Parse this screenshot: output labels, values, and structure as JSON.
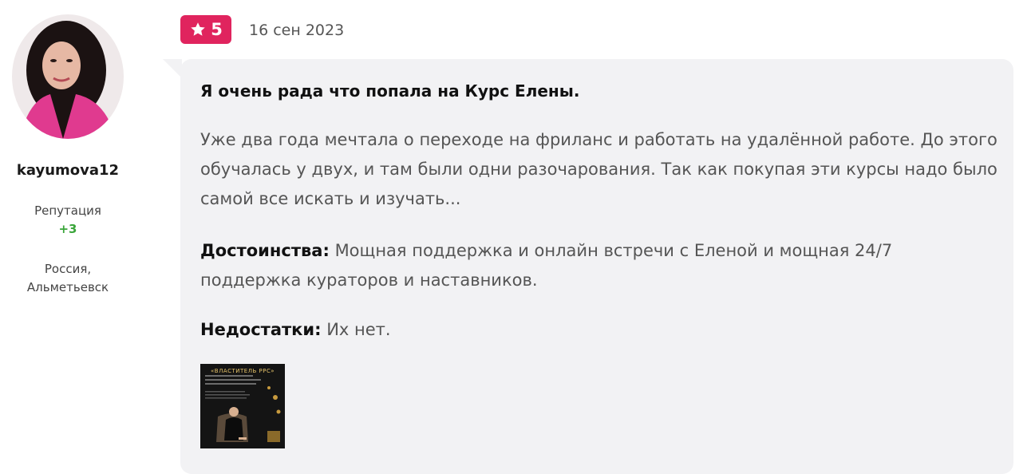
{
  "author": {
    "username": "kayumova12",
    "reputation_label": "Репутация",
    "reputation_value": "+3",
    "location_line1": "Россия,",
    "location_line2": "Альметьевск"
  },
  "review": {
    "rating": "5",
    "date": "16 сен 2023",
    "title": "Я очень рада что попала на Курс Елены.",
    "body": "Уже два года мечтала о переходе на фриланс и работать на удалённой работе. До этого обучалась у двух, и там были одни разочарования. Так как покупая эти курсы надо было самой все искать и изучать...",
    "pros_label": "Достоинства:",
    "pros_text": " Мощная поддержка и онлайн встречи с Еленой и мощная 24/7 поддержка кураторов и наставников.",
    "cons_label": "Недостатки:",
    "cons_text": " Их нет.",
    "attachment_title": "«ВЛАСТИТЕЛЬ PPC»"
  },
  "colors": {
    "badge": "#e0245e",
    "bubble": "#f2f2f4",
    "reputation": "#3aa53a"
  },
  "icons": {
    "rating": "star-icon"
  }
}
